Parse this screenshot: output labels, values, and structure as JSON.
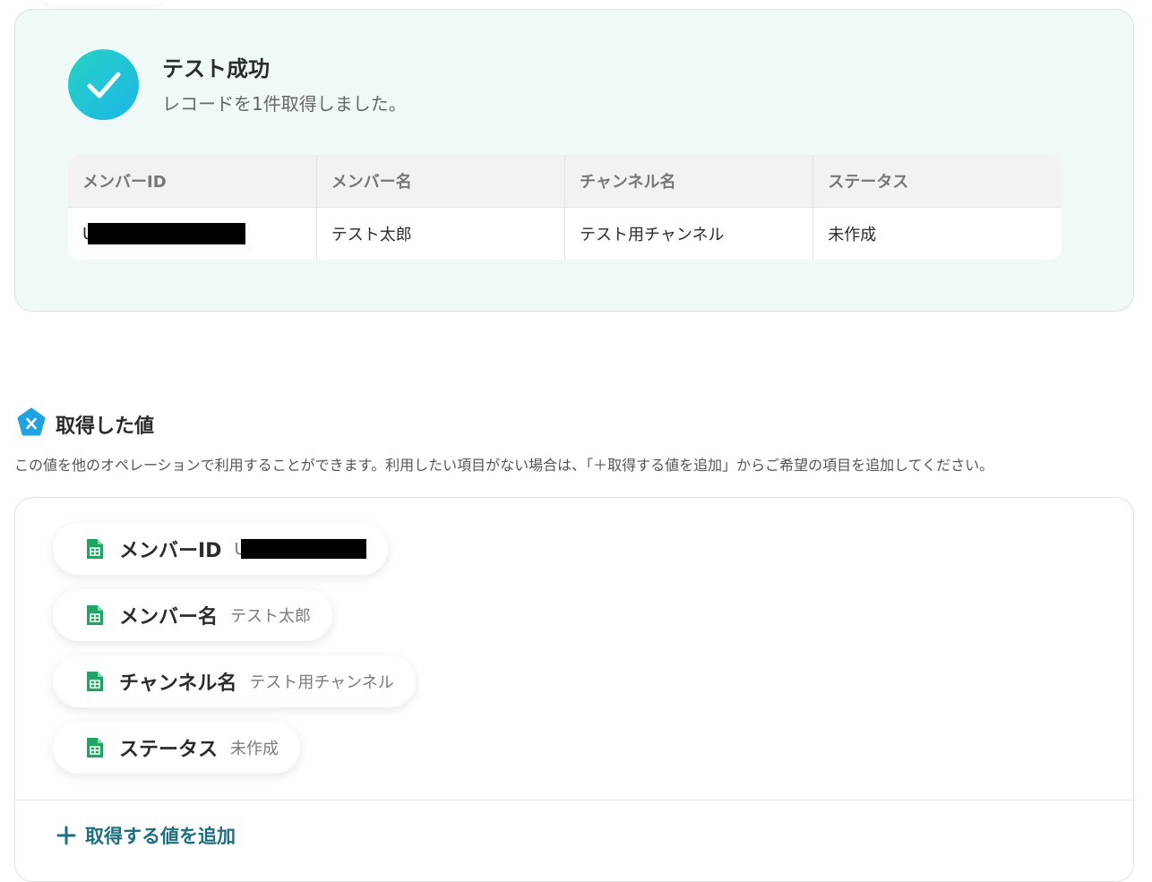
{
  "test_result": {
    "title": "テスト成功",
    "message": "レコードを1件取得しました。",
    "table": {
      "headers": [
        "メンバーID",
        "メンバー名",
        "チャンネル名",
        "ステータス"
      ],
      "rows": [
        {
          "member_id_prefix": "U",
          "member_name": "テスト太郎",
          "channel_name": "テスト用チャンネル",
          "status": "未作成"
        }
      ]
    }
  },
  "fetched_values": {
    "title": "取得した値",
    "description": "この値を他のオペレーションで利用することができます。利用したい項目がない場合は、「＋取得する値を追加」からご希望の項目を追加してください。",
    "items": [
      {
        "label": "メンバーID",
        "value": "U",
        "redacted": true
      },
      {
        "label": "メンバー名",
        "value": "テスト太郎"
      },
      {
        "label": "チャンネル名",
        "value": "テスト用チャンネル"
      },
      {
        "label": "ステータス",
        "value": "未作成"
      }
    ],
    "add_button_label": "取得する値を追加"
  },
  "colors": {
    "accent": "#1d6f80",
    "success_gradient_start": "#24d3c3",
    "success_gradient_end": "#1fb5e8",
    "sheet_icon": "#1fa463",
    "section_icon": "#1fa3e0",
    "panel_bg": "#f1f9f8"
  },
  "icons": {
    "success": "check-icon",
    "section": "variable-x-icon",
    "chip": "spreadsheet-icon",
    "add": "plus-icon"
  }
}
